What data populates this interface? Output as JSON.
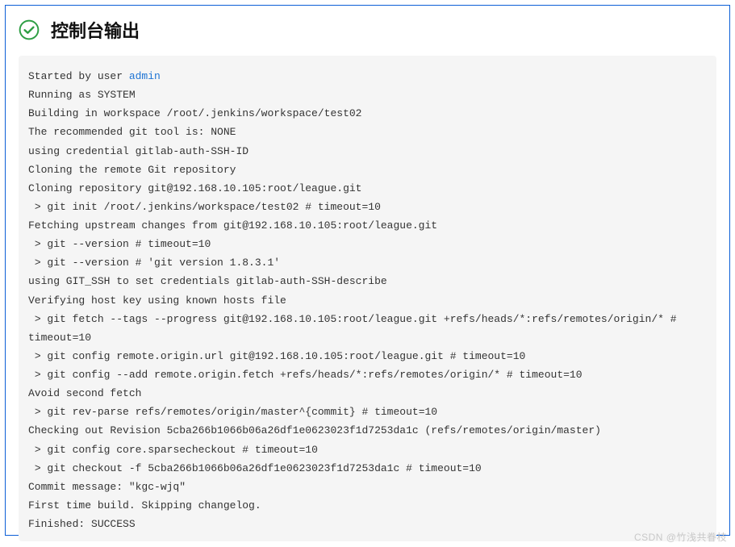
{
  "header": {
    "title": "控制台输出"
  },
  "console": {
    "line0_prefix": "Started by user ",
    "line0_user": "admin",
    "line1": "Running as SYSTEM",
    "line2": "Building in workspace /root/.jenkins/workspace/test02",
    "line3": "The recommended git tool is: NONE",
    "line4": "using credential gitlab-auth-SSH-ID",
    "line5": "Cloning the remote Git repository",
    "line6": "Cloning repository git@192.168.10.105:root/league.git",
    "line7": " > git init /root/.jenkins/workspace/test02 # timeout=10",
    "line8": "Fetching upstream changes from git@192.168.10.105:root/league.git",
    "line9": " > git --version # timeout=10",
    "line10": " > git --version # 'git version 1.8.3.1'",
    "line11": "using GIT_SSH to set credentials gitlab-auth-SSH-describe",
    "line12": "Verifying host key using known hosts file",
    "line13": " > git fetch --tags --progress git@192.168.10.105:root/league.git +refs/heads/*:refs/remotes/origin/* # timeout=10",
    "line14": " > git config remote.origin.url git@192.168.10.105:root/league.git # timeout=10",
    "line15": " > git config --add remote.origin.fetch +refs/heads/*:refs/remotes/origin/* # timeout=10",
    "line16": "Avoid second fetch",
    "line17": " > git rev-parse refs/remotes/origin/master^{commit} # timeout=10",
    "line18": "Checking out Revision 5cba266b1066b06a26df1e0623023f1d7253da1c (refs/remotes/origin/master)",
    "line19": " > git config core.sparsecheckout # timeout=10",
    "line20": " > git checkout -f 5cba266b1066b06a26df1e0623023f1d7253da1c # timeout=10",
    "line21": "Commit message: \"kgc-wjq\"",
    "line22": "First time build. Skipping changelog.",
    "line23": "Finished: SUCCESS"
  },
  "watermark": "CSDN @竹浅共眷枝"
}
